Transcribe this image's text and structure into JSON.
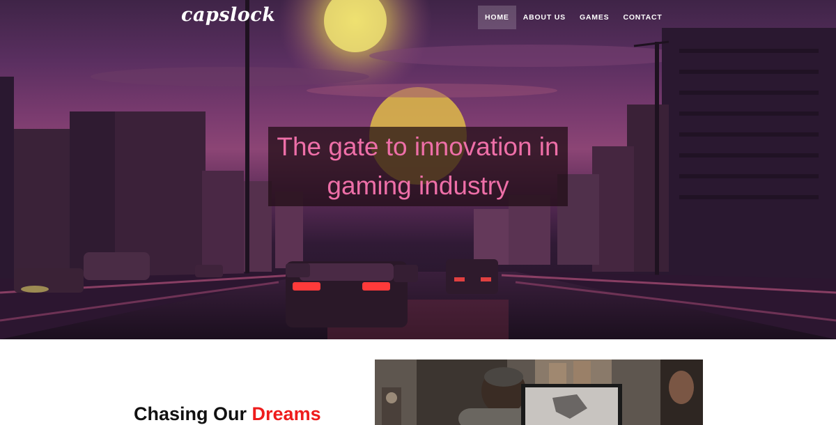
{
  "brand": {
    "name": "capslock"
  },
  "nav": {
    "items": [
      {
        "label": "HOME",
        "active": true
      },
      {
        "label": "ABOUT US",
        "active": false
      },
      {
        "label": "GAMES",
        "active": false
      },
      {
        "label": "CONTACT",
        "active": false
      }
    ]
  },
  "hero": {
    "headline_line1": "The gate to innovation in",
    "headline_line2": "gaming industry",
    "image": "synthwave-city-highway-sunset"
  },
  "about": {
    "heading_prefix": "Chasing Our",
    "heading_accent": "Dreams",
    "image": "game-developer-at-workstation"
  },
  "colors": {
    "headline_text": "#ee6fa8",
    "accent": "#ee1c1c",
    "nav_text": "#ffffff"
  }
}
